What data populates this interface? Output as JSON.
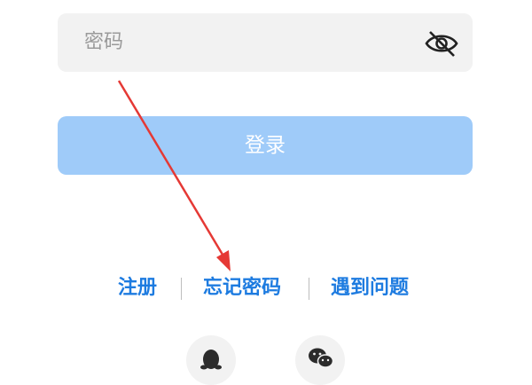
{
  "password": {
    "placeholder": "密码",
    "toggle_icon": "eye-off-icon"
  },
  "login": {
    "label": "登录"
  },
  "links": {
    "register": "注册",
    "forgot_password": "忘记密码",
    "help": "遇到问题"
  },
  "social": {
    "qq_icon": "qq-icon",
    "wechat_icon": "wechat-icon"
  },
  "colors": {
    "link": "#1d7be0",
    "button": "#9fcbf9",
    "field": "#f2f2f2",
    "arrow": "#e53935"
  }
}
